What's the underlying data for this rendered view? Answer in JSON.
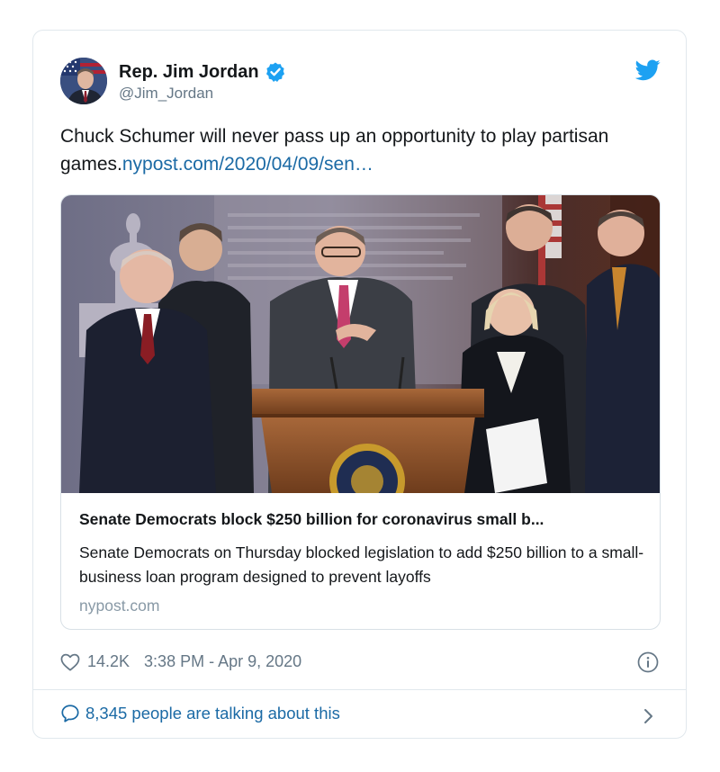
{
  "tweet": {
    "display_name": "Rep. Jim Jordan",
    "handle": "@Jim_Jordan",
    "text": "Chuck Schumer will never pass up an opportunity to play partisan games.",
    "link_text": "nypost.com/2020/04/09/sen…",
    "likes": "14.2K",
    "timestamp": "3:38 PM - Apr 9, 2020",
    "talking": "8,345 people are talking about this"
  },
  "link_card": {
    "title": "Senate Democrats block $250 billion for coronavirus small b...",
    "description": "Senate Democrats on Thursday blocked legislation to add $250 billion to a small-business loan program designed to prevent layoffs",
    "domain": "nypost.com"
  },
  "icons": {
    "verified": "verified-badge-icon",
    "brand": "twitter-bird-icon",
    "like": "heart-icon",
    "info": "info-icon",
    "reply": "speech-bubble-icon",
    "more": "chevron-right-icon"
  },
  "colors": {
    "link": "#1b6aa5",
    "twitter_blue": "#1da1f2",
    "secondary_text": "#657786",
    "border": "#e1e8ed"
  }
}
